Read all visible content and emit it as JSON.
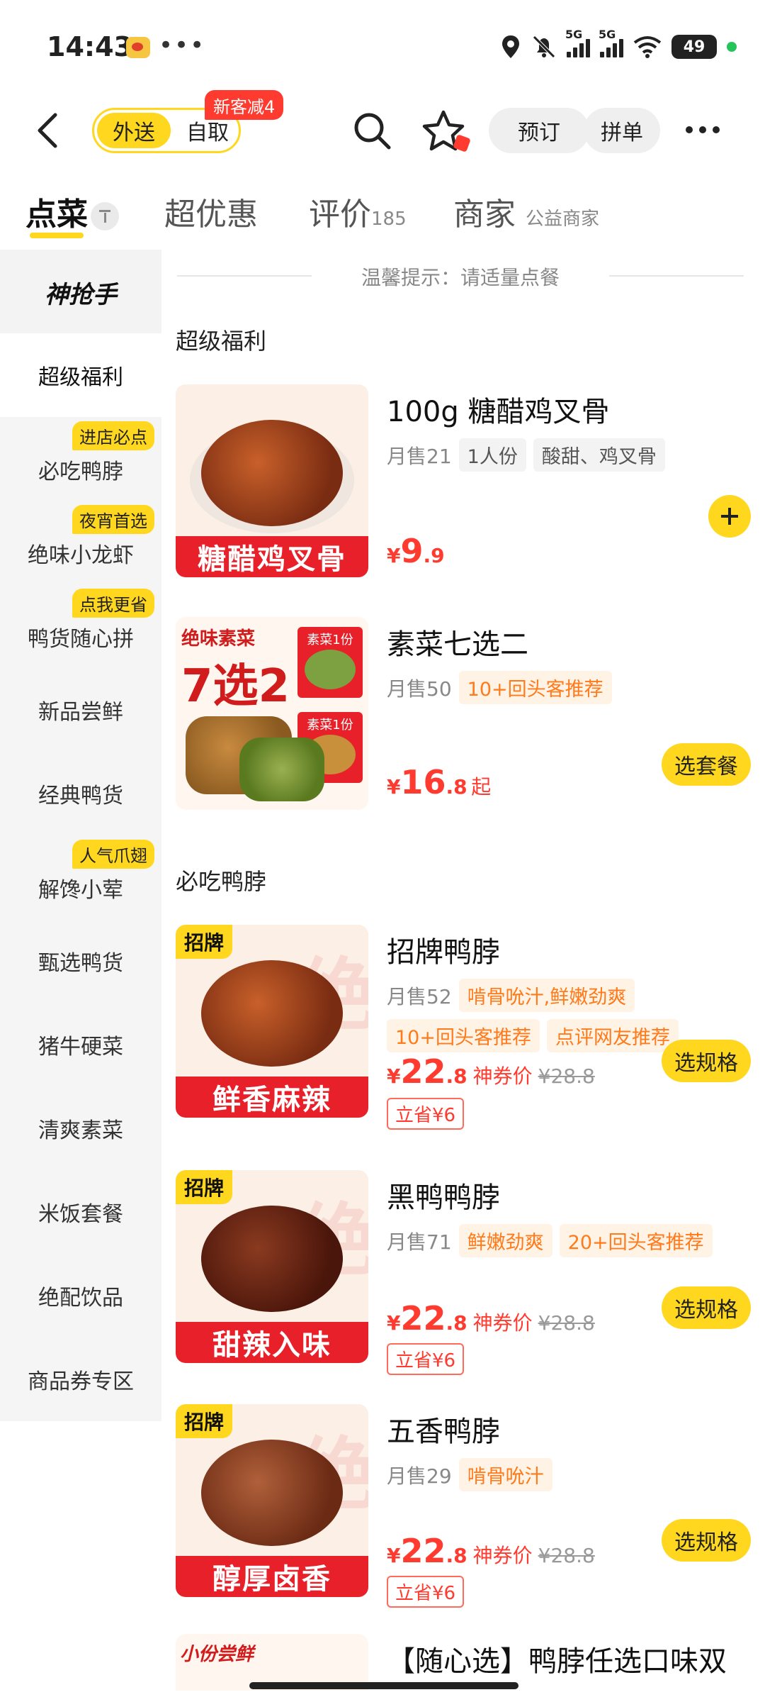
{
  "status_bar": {
    "time": "14:43",
    "battery": "49",
    "sig1": "5G",
    "sig2": "5G"
  },
  "nav": {
    "mode_active": "外送",
    "mode_other": "自取",
    "badge": "新客减4",
    "reserve": "预订",
    "group": "拼单"
  },
  "tabs": {
    "order": "点菜",
    "deals": "超优惠",
    "reviews": "评价",
    "reviews_count": "185",
    "merchant": "商家",
    "merchant_sub": "公益商家"
  },
  "sidebar": {
    "logo": "神抢手",
    "items": [
      {
        "label": "超级福利",
        "tag": ""
      },
      {
        "label": "必吃鸭脖",
        "tag": "进店必点"
      },
      {
        "label": "绝味小龙虾",
        "tag": "夜宵首选"
      },
      {
        "label": "鸭货随心拼",
        "tag": "点我更省"
      },
      {
        "label": "新品尝鲜",
        "tag": ""
      },
      {
        "label": "经典鸭货",
        "tag": ""
      },
      {
        "label": "解馋小荤",
        "tag": "人气爪翅"
      },
      {
        "label": "甄选鸭货",
        "tag": ""
      },
      {
        "label": "猪牛硬菜",
        "tag": ""
      },
      {
        "label": "清爽素菜",
        "tag": ""
      },
      {
        "label": "米饭套餐",
        "tag": ""
      },
      {
        "label": "绝配饮品",
        "tag": ""
      },
      {
        "label": "商品券专区",
        "tag": ""
      }
    ]
  },
  "content": {
    "tip": "温馨提示：请适量点餐",
    "section1": "超级福利",
    "section2": "必吃鸭脖",
    "items": [
      {
        "name": "100g 糖醋鸡叉骨",
        "sales": "月售21",
        "tags_grey": [
          "1人份",
          "酸甜、鸡叉骨"
        ],
        "tags_orange": [],
        "banner": "糖醋鸡叉骨",
        "brand": "",
        "price_cur": "¥",
        "price_int": "9",
        "price_dec": ".9",
        "price_suffix": ""
      },
      {
        "name": "素菜七选二",
        "sales": "月售50",
        "tags_grey": [],
        "tags_orange": [
          "10+回头客推荐"
        ],
        "combo_hdr": "绝味素菜",
        "combo_big": "7选2",
        "combo_box": "素菜1份",
        "price_cur": "¥",
        "price_int": "16",
        "price_dec": ".8",
        "price_suffix": "起",
        "button": "选套餐"
      },
      {
        "name": "招牌鸭脖",
        "sales": "月售52",
        "tags_orange": [
          "啃骨吮汁,鲜嫩劲爽",
          "10+回头客推荐",
          "点评网友推荐"
        ],
        "banner": "鲜香麻辣",
        "brand": "招牌",
        "price_cur": "¥",
        "price_int": "22",
        "price_dec": ".8",
        "coupon_label": "神券价",
        "orig": "¥28.8",
        "save": "立省¥6",
        "button": "选规格"
      },
      {
        "name": "黑鸭鸭脖",
        "sales": "月售71",
        "tags_orange": [
          "鲜嫩劲爽",
          "20+回头客推荐"
        ],
        "banner": "甜辣入味",
        "brand": "招牌",
        "price_cur": "¥",
        "price_int": "22",
        "price_dec": ".8",
        "coupon_label": "神券价",
        "orig": "¥28.8",
        "save": "立省¥6",
        "button": "选规格"
      },
      {
        "name": "五香鸭脖",
        "sales": "月售29",
        "tags_orange": [
          "啃骨吮汁"
        ],
        "banner": "醇厚卤香",
        "brand": "招牌",
        "price_cur": "¥",
        "price_int": "22",
        "price_dec": ".8",
        "coupon_label": "神券价",
        "orig": "¥28.8",
        "save": "立省¥6",
        "button": "选规格"
      },
      {
        "name": "【随心选】鸭脖任选口味双",
        "thumb_hdr": "小份尝鲜"
      }
    ]
  }
}
